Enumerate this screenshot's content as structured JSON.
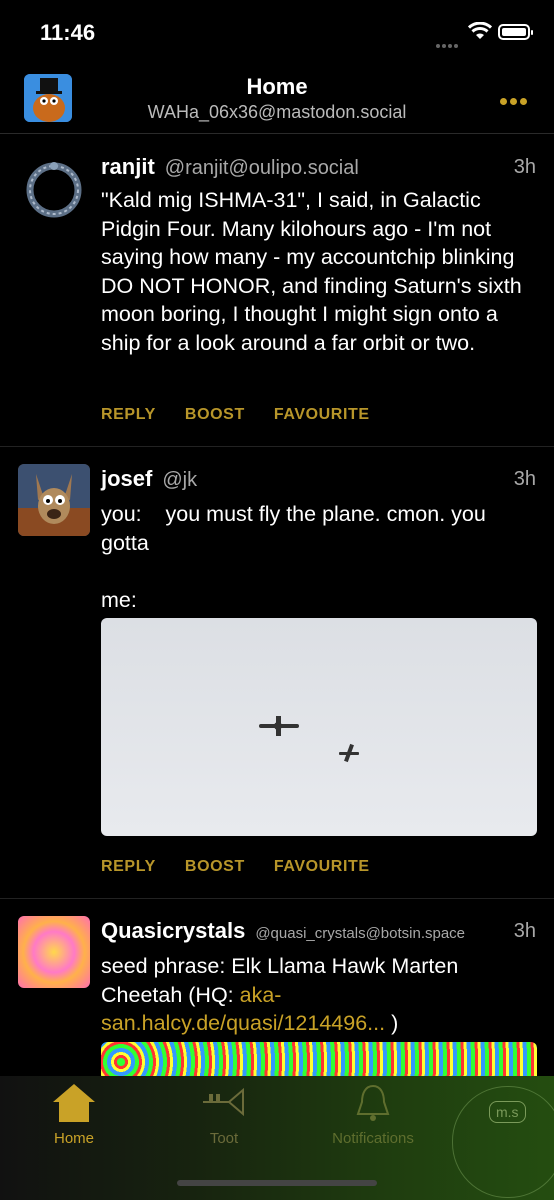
{
  "status": {
    "time": "11:46"
  },
  "header": {
    "title": "Home",
    "account": "WAHa_06x36@mastodon.social"
  },
  "posts": [
    {
      "name": "ranjit",
      "handle": "@ranjit@oulipo.social",
      "time": "3h",
      "body": "\"Kald mig ISHMA-31\", I said, in Galactic Pidgin Four. Many kilohours ago - I'm not saying how many - my accountchip blinking DO NOT HONOR, and finding Saturn's sixth moon boring, I thought I might sign onto a ship for a look around a far orbit or two."
    },
    {
      "name": "josef",
      "handle": "@jk",
      "time": "3h",
      "body": "you:    you must fly the plane. cmon. you gotta\n\nme:"
    },
    {
      "name": "Quasicrystals",
      "handle": "@quasi_crystals@botsin.space",
      "time": "3h",
      "body_prefix": "seed phrase: Elk Llama Hawk Marten Cheetah (HQ: ",
      "link": "aka-san.halcy.de/quasi/1214496...",
      "body_suffix": " )"
    }
  ],
  "actions": {
    "reply": "REPLY",
    "boost": "BOOST",
    "favourite": "FAVOURITE"
  },
  "tabs": [
    {
      "label": "Home",
      "icon": "home-icon",
      "active": true
    },
    {
      "label": "Toot",
      "icon": "trumpet-icon",
      "active": false
    },
    {
      "label": "Notifications",
      "icon": "bell-icon",
      "active": false
    }
  ],
  "floating_button": {
    "label": "m.s",
    "icon": "mastodon-social-badge"
  },
  "colors": {
    "accent": "#c9a227",
    "background": "#000000",
    "secondary_text": "#a8a8a8"
  }
}
